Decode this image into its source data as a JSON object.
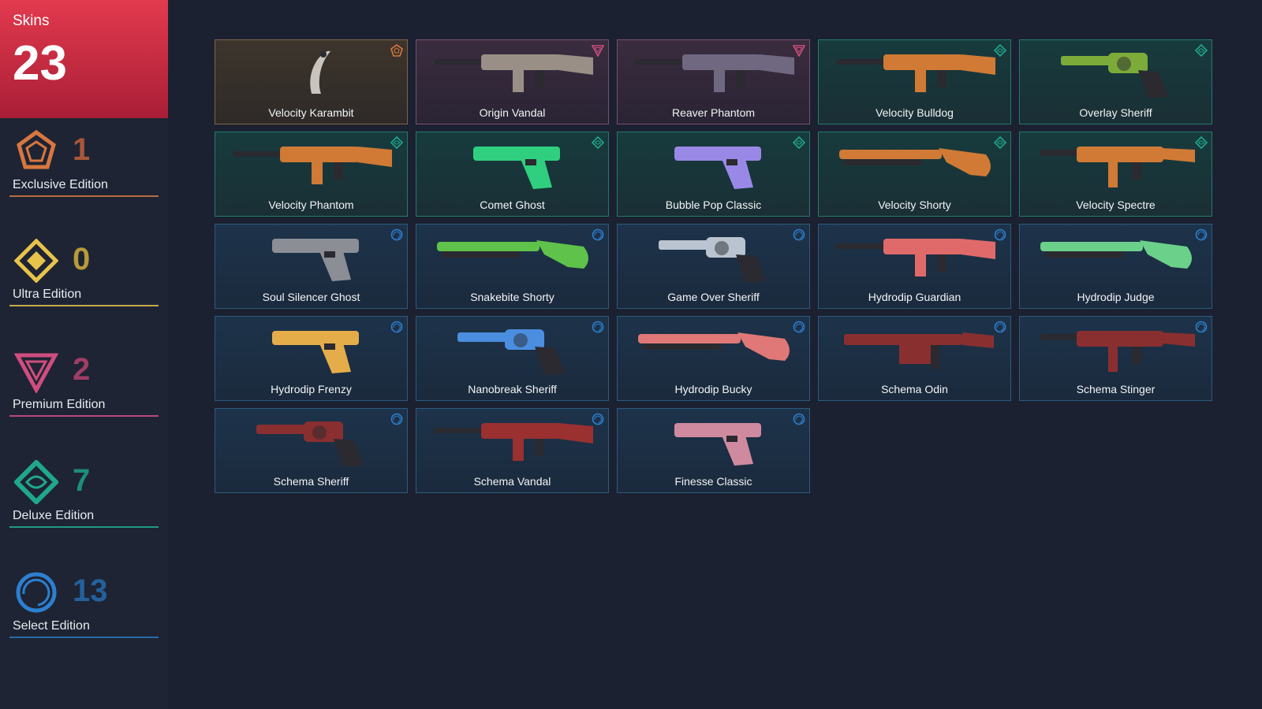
{
  "summary": {
    "label": "Skins",
    "count": "23"
  },
  "tiers": [
    {
      "key": "exclusive",
      "count": "1",
      "name": "Exclusive Edition",
      "color": "#d9763f"
    },
    {
      "key": "ultra",
      "count": "0",
      "name": "Ultra Edition",
      "color": "#e8c34a"
    },
    {
      "key": "premium",
      "count": "2",
      "name": "Premium Edition",
      "color": "#d04d7f"
    },
    {
      "key": "deluxe",
      "count": "7",
      "name": "Deluxe Edition",
      "color": "#1fa88e"
    },
    {
      "key": "select",
      "count": "13",
      "name": "Select Edition",
      "color": "#2d7fd0"
    }
  ],
  "skins": [
    {
      "name": "Velocity Karambit",
      "tier": "exclusive",
      "weapon": "knife"
    },
    {
      "name": "Origin Vandal",
      "tier": "premium",
      "weapon": "rifle"
    },
    {
      "name": "Reaver Phantom",
      "tier": "premium",
      "weapon": "rifle"
    },
    {
      "name": "Velocity Bulldog",
      "tier": "deluxe",
      "weapon": "rifle"
    },
    {
      "name": "Overlay Sheriff",
      "tier": "deluxe",
      "weapon": "revolver"
    },
    {
      "name": "Velocity Phantom",
      "tier": "deluxe",
      "weapon": "rifle"
    },
    {
      "name": "Comet Ghost",
      "tier": "deluxe",
      "weapon": "pistol"
    },
    {
      "name": "Bubble Pop Classic",
      "tier": "deluxe",
      "weapon": "pistol"
    },
    {
      "name": "Velocity Shorty",
      "tier": "deluxe",
      "weapon": "shotgun"
    },
    {
      "name": "Velocity Spectre",
      "tier": "deluxe",
      "weapon": "smg"
    },
    {
      "name": "Soul Silencer Ghost",
      "tier": "select",
      "weapon": "pistol"
    },
    {
      "name": "Snakebite Shorty",
      "tier": "select",
      "weapon": "shotgun"
    },
    {
      "name": "Game Over Sheriff",
      "tier": "select",
      "weapon": "revolver"
    },
    {
      "name": "Hydrodip Guardian",
      "tier": "select",
      "weapon": "rifle"
    },
    {
      "name": "Hydrodip Judge",
      "tier": "select",
      "weapon": "shotgun"
    },
    {
      "name": "Hydrodip Frenzy",
      "tier": "select",
      "weapon": "pistol"
    },
    {
      "name": "Nanobreak Sheriff",
      "tier": "select",
      "weapon": "revolver"
    },
    {
      "name": "Hydrodip Bucky",
      "tier": "select",
      "weapon": "shotgun"
    },
    {
      "name": "Schema Odin",
      "tier": "select",
      "weapon": "lmg"
    },
    {
      "name": "Schema Stinger",
      "tier": "select",
      "weapon": "smg"
    },
    {
      "name": "Schema Sheriff",
      "tier": "select",
      "weapon": "revolver"
    },
    {
      "name": "Schema Vandal",
      "tier": "select",
      "weapon": "rifle"
    },
    {
      "name": "Finesse Classic",
      "tier": "select",
      "weapon": "pistol"
    }
  ],
  "weapon_colors": {
    "Velocity Karambit": "#c9c4bd",
    "Origin Vandal": "#9a8f86",
    "Reaver Phantom": "#6f6880",
    "Velocity Bulldog": "#d07a35",
    "Overlay Sheriff": "#7cab3a",
    "Velocity Phantom": "#d07a35",
    "Comet Ghost": "#2fcf7f",
    "Bubble Pop Classic": "#9a88e6",
    "Velocity Shorty": "#d07a35",
    "Velocity Spectre": "#d07a35",
    "Soul Silencer Ghost": "#8b8e95",
    "Snakebite Shorty": "#5fc24a",
    "Game Over Sheriff": "#b9c4d0",
    "Hydrodip Guardian": "#e06a6a",
    "Hydrodip Judge": "#6ad08a",
    "Hydrodip Frenzy": "#e5ad4a",
    "Nanobreak Sheriff": "#4b8ee0",
    "Hydrodip Bucky": "#e07878",
    "Schema Odin": "#8a2f30",
    "Schema Stinger": "#8a2f30",
    "Schema Sheriff": "#8a2f30",
    "Schema Vandal": "#9a3030",
    "Finesse Classic": "#d08aa0"
  }
}
